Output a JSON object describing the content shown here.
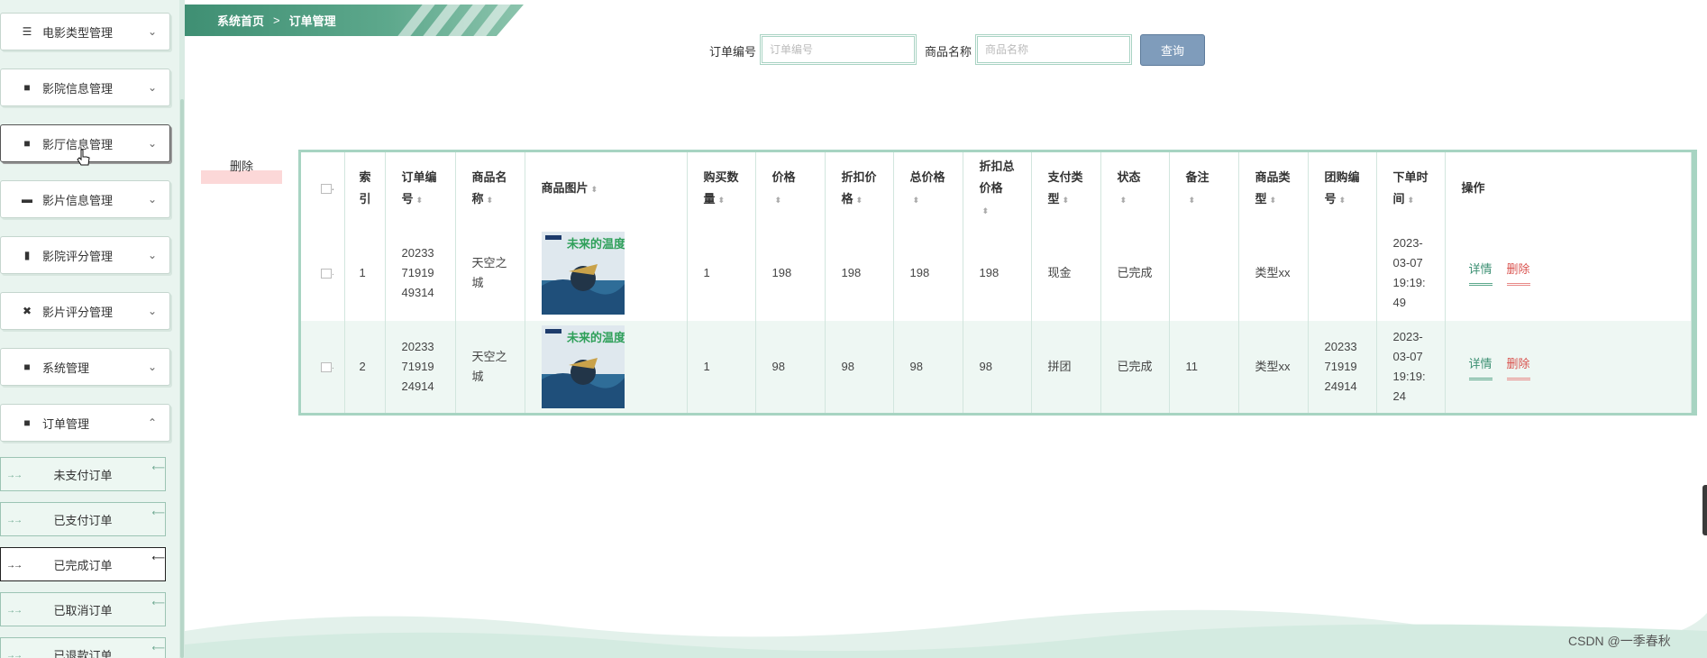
{
  "sidebar": {
    "menu": [
      {
        "label": "电影类型管理",
        "icon": "list-icon",
        "glyph": "☰",
        "chevron": "⌄"
      },
      {
        "label": "影院信息管理",
        "icon": "grid-icon",
        "glyph": "■",
        "chevron": "⌄"
      },
      {
        "label": "影厅信息管理",
        "icon": "grid-icon",
        "glyph": "■",
        "chevron": "⌄"
      },
      {
        "label": "影片信息管理",
        "icon": "film-icon",
        "glyph": "▬",
        "chevron": "⌄"
      },
      {
        "label": "影院评分管理",
        "icon": "bar-chart-icon",
        "glyph": "▮",
        "chevron": "⌄"
      },
      {
        "label": "影片评分管理",
        "icon": "clipboard-icon",
        "glyph": "✖",
        "chevron": "⌄"
      },
      {
        "label": "系统管理",
        "icon": "grid-icon",
        "glyph": "■",
        "chevron": "⌄"
      },
      {
        "label": "订单管理",
        "icon": "grid-icon",
        "glyph": "■",
        "chevron": "⌃"
      }
    ],
    "submenu": [
      {
        "label": "未支付订单"
      },
      {
        "label": "已支付订单"
      },
      {
        "label": "已完成订单"
      },
      {
        "label": "已取消订单"
      },
      {
        "label": "已退款订单"
      }
    ]
  },
  "breadcrumb": {
    "home": "系统首页",
    "separator": ">",
    "current": "订单管理"
  },
  "search": {
    "order_no_label": "订单编号",
    "order_no_placeholder": "订单编号",
    "order_no_value": "",
    "product_name_label": "商品名称",
    "product_name_placeholder": "商品名称",
    "product_name_value": "",
    "query_button": "查询"
  },
  "toolbar": {
    "delete_label": "删除"
  },
  "table": {
    "headers": {
      "index": "索引",
      "order_no": "订单编号",
      "product_name": "商品名称",
      "product_image": "商品图片",
      "quantity": "购买数量",
      "price": "价格",
      "discount_price": "折扣价格",
      "total_price": "总价格",
      "discount_total": "折扣总价格",
      "payment_type": "支付类型",
      "status": "状态",
      "remark": "备注",
      "product_type": "商品类型",
      "group_buy_no": "团购编号",
      "order_time": "下单时间",
      "actions": "操作"
    },
    "rows": [
      {
        "index": "1",
        "order_no": "2023371919 49314",
        "order_no_lines": [
          "20233",
          "71919",
          "49314"
        ],
        "product_name_lines": [
          "天空之",
          "城"
        ],
        "quantity": "1",
        "price": "198",
        "discount_price": "198",
        "total_price": "198",
        "discount_total": "198",
        "payment_type": "现金",
        "status": "已完成",
        "remark": "",
        "product_type": "类型xx",
        "group_buy_no_lines": [
          "",
          "",
          ""
        ],
        "order_time_lines": [
          "2023-",
          "03-07",
          "19:19:",
          "49"
        ],
        "detail_label": "详情",
        "delete_label": "删除"
      },
      {
        "index": "2",
        "order_no_lines": [
          "20233",
          "71919",
          "24914"
        ],
        "product_name_lines": [
          "天空之",
          "城"
        ],
        "quantity": "1",
        "price": "98",
        "discount_price": "98",
        "total_price": "98",
        "discount_total": "98",
        "payment_type": "拼团",
        "status": "已完成",
        "remark": "11",
        "product_type": "类型xx",
        "group_buy_no_lines": [
          "20233",
          "71919",
          "24914"
        ],
        "order_time_lines": [
          "2023-",
          "03-07",
          "19:19:",
          "24"
        ],
        "detail_label": "详情",
        "delete_label": "删除"
      }
    ]
  },
  "poster": {
    "title": "未来的温度"
  },
  "watermark": "CSDN @一季春秋",
  "colors": {
    "theme_green": "#5da88c",
    "sidebar_bg": "#e9f4ef",
    "query_button": "#7f9cbb",
    "delete_red": "#d9534f"
  }
}
